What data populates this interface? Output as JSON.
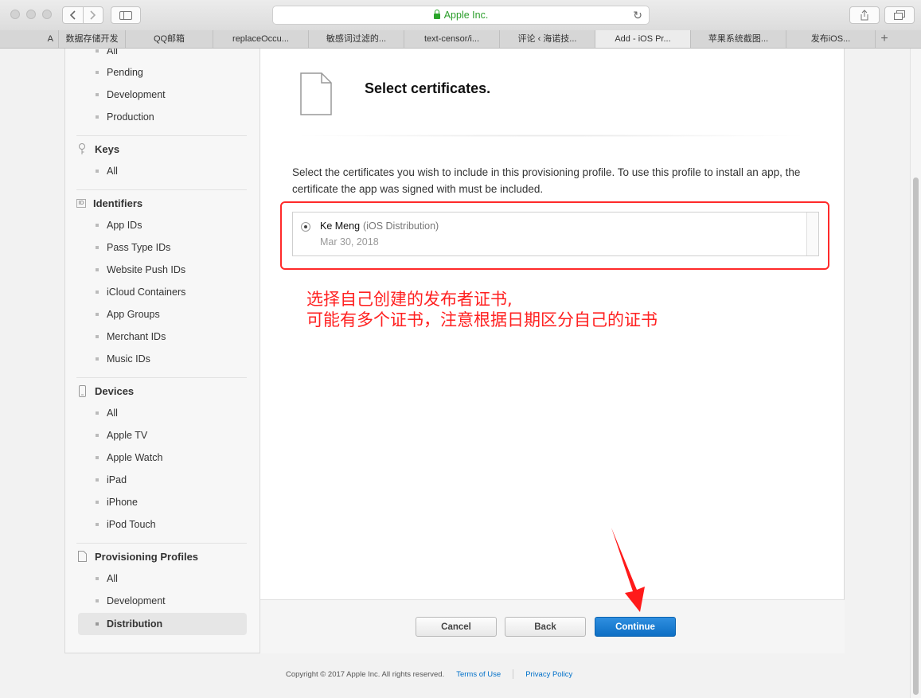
{
  "browser": {
    "url_text": "Apple Inc.",
    "tabs": [
      {
        "label": "A"
      },
      {
        "label": "数据存储开发"
      },
      {
        "label": "QQ邮箱"
      },
      {
        "label": "replaceOccu..."
      },
      {
        "label": "敏感词过滤的..."
      },
      {
        "label": "text-censor/i..."
      },
      {
        "label": "评论 ‹ 海诺技..."
      },
      {
        "label": "Add - iOS Pr..."
      },
      {
        "label": "苹果系统截图..."
      },
      {
        "label": "发布iOS..."
      }
    ],
    "add_tab": "+"
  },
  "sidebar": {
    "top_items": [
      "All",
      "Pending",
      "Development",
      "Production"
    ],
    "keys": {
      "title": "Keys",
      "items": [
        "All"
      ]
    },
    "identifiers": {
      "title": "Identifiers",
      "icon_text": "ID",
      "items": [
        "App IDs",
        "Pass Type IDs",
        "Website Push IDs",
        "iCloud Containers",
        "App Groups",
        "Merchant IDs",
        "Music IDs"
      ]
    },
    "devices": {
      "title": "Devices",
      "items": [
        "All",
        "Apple TV",
        "Apple Watch",
        "iPad",
        "iPhone",
        "iPod Touch"
      ]
    },
    "profiles": {
      "title": "Provisioning Profiles",
      "items": [
        "All",
        "Development",
        "Distribution"
      ]
    }
  },
  "content": {
    "title": "Select certificates.",
    "description": "Select the certificates you wish to include in this provisioning profile. To use this profile to install an app, the certificate the app was signed with must be included.",
    "certificate": {
      "name": "Ke Meng",
      "type": "(iOS Distribution)",
      "date": "Mar 30, 2018"
    },
    "annotation_line1": "选择自己创建的发布者证书,",
    "annotation_line2": "可能有多个证书，注意根据日期区分自己的证书",
    "buttons": {
      "cancel": "Cancel",
      "back": "Back",
      "continue": "Continue"
    }
  },
  "footer": {
    "copyright": "Copyright © 2017 Apple Inc. All rights reserved.",
    "terms": "Terms of Use",
    "privacy": "Privacy Policy"
  },
  "colors": {
    "accent": "#0d6fc4",
    "annotation": "#ff2020",
    "secure": "#2aa52a"
  }
}
